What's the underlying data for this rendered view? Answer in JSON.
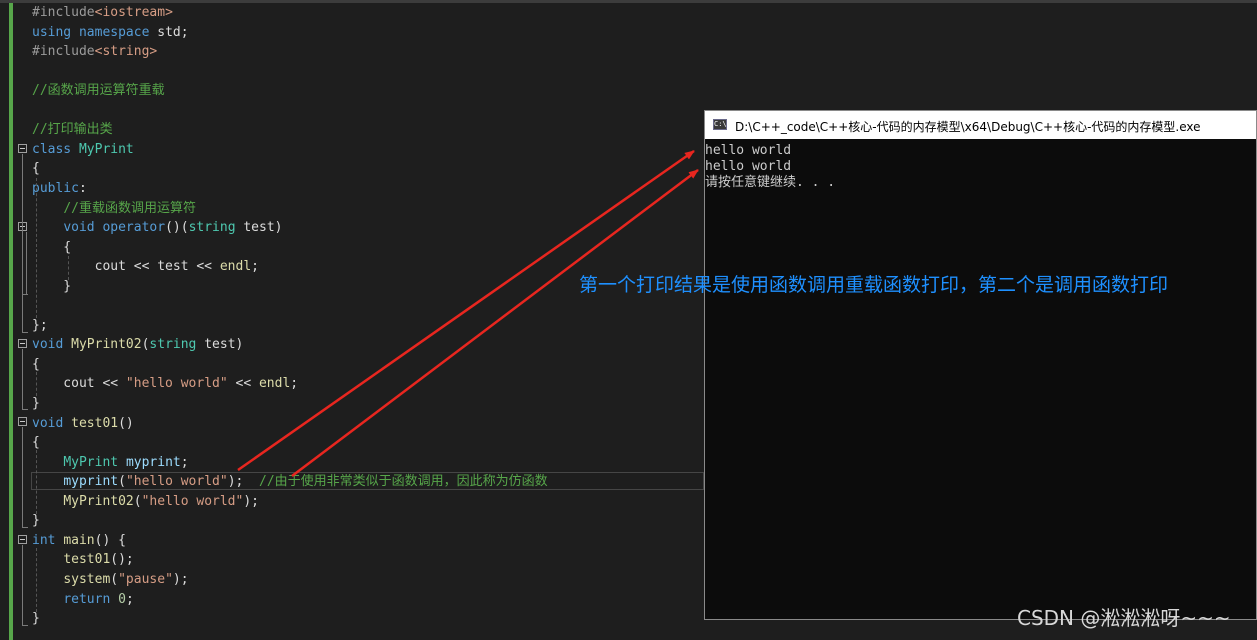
{
  "editor": {
    "lines": [
      [
        {
          "t": "#include",
          "c": "pp"
        },
        {
          "t": "<iostream>",
          "c": "str"
        }
      ],
      [
        {
          "t": "using",
          "c": "kw"
        },
        {
          "t": " ",
          "c": "plain"
        },
        {
          "t": "namespace",
          "c": "kw"
        },
        {
          "t": " std;",
          "c": "plain"
        }
      ],
      [
        {
          "t": "#include",
          "c": "pp"
        },
        {
          "t": "<string>",
          "c": "str"
        }
      ],
      [],
      [
        {
          "t": "//函数调用运算符重载",
          "c": "cmt"
        }
      ],
      [],
      [
        {
          "t": "//打印输出类",
          "c": "cmt"
        }
      ],
      [
        {
          "t": "class",
          "c": "kw"
        },
        {
          "t": " ",
          "c": "plain"
        },
        {
          "t": "MyPrint",
          "c": "type"
        }
      ],
      [
        {
          "t": "{",
          "c": "plain"
        }
      ],
      [
        {
          "t": "public",
          "c": "kw"
        },
        {
          "t": ":",
          "c": "plain"
        }
      ],
      [
        {
          "t": "    ",
          "c": "plain"
        },
        {
          "t": "//重载函数调用运算符",
          "c": "cmt"
        }
      ],
      [
        {
          "t": "    ",
          "c": "plain"
        },
        {
          "t": "void",
          "c": "kw"
        },
        {
          "t": " ",
          "c": "plain"
        },
        {
          "t": "operator",
          "c": "kw"
        },
        {
          "t": "()(",
          "c": "plain"
        },
        {
          "t": "string",
          "c": "type"
        },
        {
          "t": " test)",
          "c": "plain"
        }
      ],
      [
        {
          "t": "    {",
          "c": "plain"
        }
      ],
      [
        {
          "t": "        cout << test << ",
          "c": "plain"
        },
        {
          "t": "endl",
          "c": "fn"
        },
        {
          "t": ";",
          "c": "plain"
        }
      ],
      [
        {
          "t": "    }",
          "c": "plain"
        }
      ],
      [],
      [
        {
          "t": "};",
          "c": "plain"
        }
      ],
      [
        {
          "t": "void",
          "c": "kw"
        },
        {
          "t": " ",
          "c": "plain"
        },
        {
          "t": "MyPrint02",
          "c": "fn"
        },
        {
          "t": "(",
          "c": "plain"
        },
        {
          "t": "string",
          "c": "type"
        },
        {
          "t": " test)",
          "c": "plain"
        }
      ],
      [
        {
          "t": "{",
          "c": "plain"
        }
      ],
      [
        {
          "t": "    cout << ",
          "c": "plain"
        },
        {
          "t": "\"hello world\"",
          "c": "str"
        },
        {
          "t": " << ",
          "c": "plain"
        },
        {
          "t": "endl",
          "c": "fn"
        },
        {
          "t": ";",
          "c": "plain"
        }
      ],
      [
        {
          "t": "}",
          "c": "plain"
        }
      ],
      [
        {
          "t": "void",
          "c": "kw"
        },
        {
          "t": " ",
          "c": "plain"
        },
        {
          "t": "test01",
          "c": "fn"
        },
        {
          "t": "()",
          "c": "plain"
        }
      ],
      [
        {
          "t": "{",
          "c": "plain"
        }
      ],
      [
        {
          "t": "    ",
          "c": "plain"
        },
        {
          "t": "MyPrint",
          "c": "type"
        },
        {
          "t": " ",
          "c": "plain"
        },
        {
          "t": "myprint",
          "c": "var"
        },
        {
          "t": ";",
          "c": "plain"
        }
      ],
      [
        {
          "t": "    ",
          "c": "plain"
        },
        {
          "t": "myprint",
          "c": "var"
        },
        {
          "t": "(",
          "c": "plain"
        },
        {
          "t": "\"hello world\"",
          "c": "str"
        },
        {
          "t": ");  ",
          "c": "plain"
        },
        {
          "t": "//由于使用非常类似于函数调用，因此称为仿函数",
          "c": "cmt"
        }
      ],
      [
        {
          "t": "    ",
          "c": "plain"
        },
        {
          "t": "MyPrint02",
          "c": "fn"
        },
        {
          "t": "(",
          "c": "plain"
        },
        {
          "t": "\"hello world\"",
          "c": "str"
        },
        {
          "t": ");",
          "c": "plain"
        }
      ],
      [
        {
          "t": "}",
          "c": "plain"
        }
      ],
      [
        {
          "t": "int",
          "c": "kw"
        },
        {
          "t": " ",
          "c": "plain"
        },
        {
          "t": "main",
          "c": "fn"
        },
        {
          "t": "() {",
          "c": "plain"
        }
      ],
      [
        {
          "t": "    ",
          "c": "plain"
        },
        {
          "t": "test01",
          "c": "fn"
        },
        {
          "t": "();",
          "c": "plain"
        }
      ],
      [
        {
          "t": "    ",
          "c": "plain"
        },
        {
          "t": "system",
          "c": "fn"
        },
        {
          "t": "(",
          "c": "plain"
        },
        {
          "t": "\"pause\"",
          "c": "str"
        },
        {
          "t": ");",
          "c": "plain"
        }
      ],
      [
        {
          "t": "    ",
          "c": "plain"
        },
        {
          "t": "return",
          "c": "kw"
        },
        {
          "t": " ",
          "c": "plain"
        },
        {
          "t": "0",
          "c": "num"
        },
        {
          "t": ";",
          "c": "plain"
        }
      ],
      [
        {
          "t": "}",
          "c": "plain"
        }
      ]
    ]
  },
  "console": {
    "title": "D:\\C++_code\\C++核心-代码的内存模型\\x64\\Debug\\C++核心-代码的内存模型.exe",
    "icon_text": "C:\\",
    "output": [
      "hello world",
      "hello world",
      "请按任意键继续. . ."
    ]
  },
  "annotation": "第一个打印结果是使用函数调用重载函数打印，第二个是调用函数打印",
  "watermark": "CSDN @淞淞淞呀~~~",
  "colors": {
    "arrow": "#e8261f",
    "annotation": "#1e90ff",
    "keyword": "#569cd6",
    "type": "#4ec9b0",
    "function": "#dcdcaa",
    "string": "#d69d85",
    "comment": "#57a64a"
  }
}
